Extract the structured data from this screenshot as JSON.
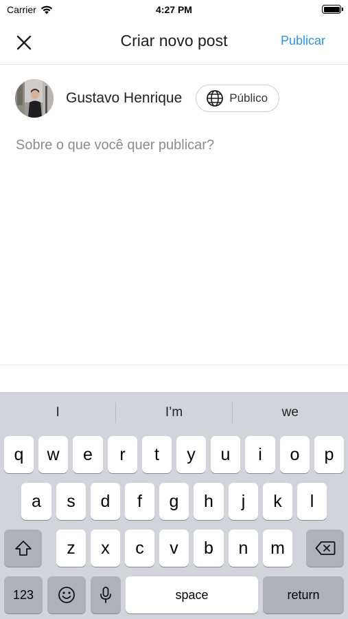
{
  "status_bar": {
    "carrier": "Carrier",
    "time": "4:27 PM"
  },
  "nav": {
    "title": "Criar novo post",
    "publish_label": "Publicar"
  },
  "author": {
    "name": "Gustavo Henrique",
    "privacy_label": "Público"
  },
  "composer": {
    "placeholder": "Sobre o que você quer publicar?",
    "value": ""
  },
  "keyboard": {
    "suggestions": [
      "I",
      "I’m",
      "we"
    ],
    "row1": [
      "q",
      "w",
      "e",
      "r",
      "t",
      "y",
      "u",
      "i",
      "o",
      "p"
    ],
    "row2": [
      "a",
      "s",
      "d",
      "f",
      "g",
      "h",
      "j",
      "k",
      "l"
    ],
    "row3": [
      "z",
      "x",
      "c",
      "v",
      "b",
      "n",
      "m"
    ],
    "numbers_label": "123",
    "space_label": "space",
    "return_label": "return"
  },
  "colors": {
    "accent": "#2a94e6",
    "keyboard_bg": "#d1d4db",
    "key_dark": "#acb1ba"
  },
  "icons": [
    "wifi-icon",
    "battery-icon",
    "close-icon",
    "globe-icon",
    "shift-icon",
    "emoji-icon",
    "microphone-icon",
    "backspace-icon"
  ]
}
